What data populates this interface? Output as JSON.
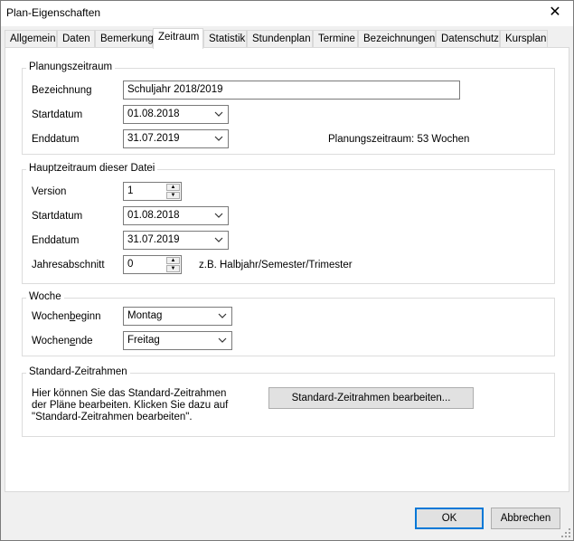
{
  "window": {
    "title": "Plan-Eigenschaften"
  },
  "tabs": [
    "Allgemein",
    "Daten",
    "Bemerkung",
    "Zeitraum",
    "Statistik",
    "Stundenplan",
    "Termine",
    "Bezeichnungen",
    "Datenschutz",
    "Kursplan"
  ],
  "active_tab": "Zeitraum",
  "planungszeitraum": {
    "title": "Planungszeitraum",
    "bezeichnung_label": "Bezeichnung",
    "bezeichnung_value": "Schuljahr 2018/2019",
    "startdatum_label": "Startdatum",
    "startdatum_value": "01.08.2018",
    "enddatum_label": "Enddatum",
    "enddatum_value": "31.07.2019",
    "info": "Planungszeitraum: 53 Wochen"
  },
  "hauptzeitraum": {
    "title": "Hauptzeitraum dieser Datei",
    "version_label": "Version",
    "version_value": "1",
    "startdatum_label": "Startdatum",
    "startdatum_value": "01.08.2018",
    "enddatum_label": "Enddatum",
    "enddatum_value": "31.07.2019",
    "jahresabschnitt_label": "Jahresabschnitt",
    "jahresabschnitt_value": "0",
    "jahresabschnitt_hint": "z.B. Halbjahr/Semester/Trimester"
  },
  "woche": {
    "title": "Woche",
    "beginn_label_pre": "Wochen",
    "beginn_label_ul": "b",
    "beginn_label_post": "eginn",
    "beginn_value": "Montag",
    "ende_label_pre": "Wochen",
    "ende_label_ul": "e",
    "ende_label_post": "nde",
    "ende_value": "Freitag"
  },
  "standard_zeitrahmen": {
    "title": "Standard-Zeitrahmen",
    "text_line1": "Hier können Sie das Standard-Zeitrahmen",
    "text_line2": "der Pläne bearbeiten. Klicken Sie dazu auf",
    "text_line3": "\"Standard-Zeitrahmen bearbeiten\".",
    "button_label": "Standard-Zeitrahmen bearbeiten..."
  },
  "footer": {
    "ok_label": "OK",
    "cancel_label": "Abbrechen"
  }
}
